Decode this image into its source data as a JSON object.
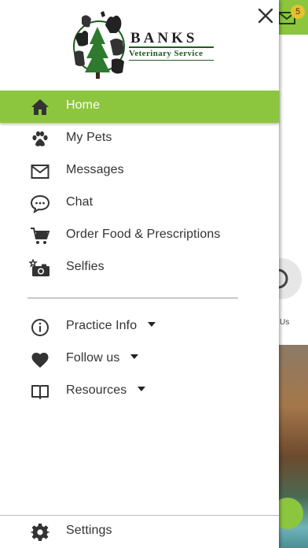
{
  "background": {
    "badge_count": "5",
    "circle_label": "Us"
  },
  "logo": {
    "name": "BANKS",
    "subtitle": "Veterinary Service"
  },
  "nav": {
    "items": [
      {
        "label": "Home",
        "icon": "home-icon",
        "active": true
      },
      {
        "label": "My Pets",
        "icon": "paw-icon"
      },
      {
        "label": "Messages",
        "icon": "envelope-icon"
      },
      {
        "label": "Chat",
        "icon": "chat-bubble-icon"
      },
      {
        "label": "Order Food & Prescriptions",
        "icon": "shopping-cart-icon"
      },
      {
        "label": "Selfies",
        "icon": "camera-icon"
      }
    ],
    "secondary": [
      {
        "label": "Practice Info",
        "icon": "info-icon",
        "dropdown": true
      },
      {
        "label": "Follow us",
        "icon": "heart-icon",
        "dropdown": true
      },
      {
        "label": "Resources",
        "icon": "book-icon",
        "dropdown": true
      }
    ],
    "settings": {
      "label": "Settings",
      "icon": "gear-icon"
    }
  },
  "colors": {
    "accent": "#8cc63f",
    "logo_green": "#1e5c22",
    "text": "#333333",
    "icon": "#333333"
  }
}
